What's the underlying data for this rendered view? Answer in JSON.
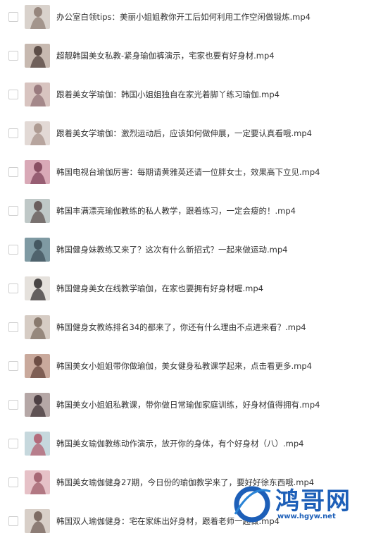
{
  "files": [
    {
      "name": "办公室白领tips：美丽小姐姐教你开工后如何利用工作空闲做锻炼.mp4",
      "thumb": "office-yoga-thumbnail",
      "bg": "#d9d2cc",
      "fg": "#8b7a70"
    },
    {
      "name": "超靓韩国美女私教-紧身瑜伽裤演示，宅家也要有好身材.mp4",
      "thumb": "yoga-pants-thumbnail",
      "bg": "#c7b9b0",
      "fg": "#4a3b36"
    },
    {
      "name": "跟着美女学瑜伽：韩国小姐姐独自在家光着脚丫练习瑜伽.mp4",
      "thumb": "home-yoga-thumbnail",
      "bg": "#d8c4c0",
      "fg": "#8f6f73"
    },
    {
      "name": "跟着美女学瑜伽：激烈运动后，应该如何做伸展，一定要认真看哦.mp4",
      "thumb": "stretching-thumbnail",
      "bg": "#e2d9d5",
      "fg": "#a58f86"
    },
    {
      "name": "韩国电视台瑜伽厉害：每期请黄雅英还请一位胖女士，效果高下立见.mp4",
      "thumb": "tv-yoga-thumbnail",
      "bg": "#d9a9b7",
      "fg": "#7a3f55"
    },
    {
      "name": "韩国丰满漂亮瑜伽教练的私人教学，跟着练习，一定会瘦的！.mp4",
      "thumb": "private-lesson-thumbnail",
      "bg": "#bfc8c7",
      "fg": "#5a4b4a"
    },
    {
      "name": "韩国健身妹教练又来了？这次有什么新招式？一起来做运动.mp4",
      "thumb": "fitness-coach-thumbnail",
      "bg": "#7f9aa3",
      "fg": "#3b4c56"
    },
    {
      "name": "韩国健身美女在线教学瑜伽，在家也要拥有好身材喔.mp4",
      "thumb": "online-yoga-thumbnail",
      "bg": "#e5e1dc",
      "fg": "#2e2a2a"
    },
    {
      "name": "韩国健身女教练排名34的都来了，你还有什么理由不点进来看？.mp4",
      "thumb": "ranking-thumbnail",
      "bg": "#d6ccc4",
      "fg": "#7b6b5f"
    },
    {
      "name": "韩国美女小姐姐带你做瑜伽，美女健身私教课学起来，点击看更多.mp4",
      "thumb": "yoga-class-thumbnail",
      "bg": "#c9a99c",
      "fg": "#5e3e36"
    },
    {
      "name": "韩国美女小姐姐私教课，带你做日常瑜伽家庭训练，好身材值得拥有.mp4",
      "thumb": "daily-training-thumbnail",
      "bg": "#b5a7a6",
      "fg": "#3b2e32"
    },
    {
      "name": "韩国美女瑜伽教练动作演示，放开你的身体，有个好身材（八）.mp4",
      "thumb": "demo-thumbnail",
      "bg": "#c6d8dd",
      "fg": "#b0586a"
    },
    {
      "name": "韩国美女瑜伽健身27期，今日份的瑜伽教学来了，要好好徐东西哦.mp4",
      "thumb": "episode27-thumbnail",
      "bg": "#e6c1c7",
      "fg": "#9b5866"
    },
    {
      "name": "韩国双人瑜伽健身：宅在家练出好身材，跟着老师一起做.mp4",
      "thumb": "partner-yoga-thumbnail",
      "bg": "#d8cfc8",
      "fg": "#6e5a52"
    }
  ],
  "watermark": {
    "title": "鸿哥网",
    "url": "www.hgyw.net"
  }
}
